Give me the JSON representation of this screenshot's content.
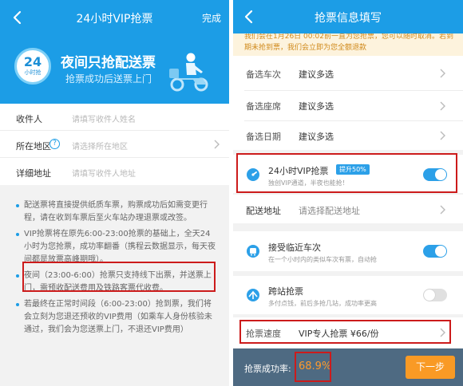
{
  "left": {
    "header": {
      "title": "24小时VIP抢票",
      "done_label": "完成"
    },
    "banner": {
      "badge_num": "24",
      "badge_sub": "小时抢",
      "title": "夜间只抢配送票",
      "subtitle": "抢票成功后送票上门"
    },
    "form": {
      "recipient": {
        "label": "收件人",
        "placeholder": "请填写收件人姓名"
      },
      "region": {
        "label": "所在地区",
        "placeholder": "请选择所在地区"
      },
      "address": {
        "label": "详细地址",
        "placeholder": "请填写收件人地址"
      }
    },
    "notes": [
      "配送票将直接提供纸质车票，购票成功后如需变更行程，请在收到车票后至火车站办理退票或改签。",
      "VIP抢票将在原先6:00-23:00抢票的基础上，全天24小时为您抢票，成功率翻番（携程云数据显示，每天夜间都是放票高峰期哦）。",
      "夜间（23:00-6:00）抢票只支持线下出票，并送票上门，需预收配送费用及铁路客票代收费。",
      "若最终在正常时间段（6:00-23:00）抢到票，我们将会立刻为您退还预收的VIP费用（如乘车人身份核验未通过，我们会为您送票上门，不退还VIP费用）"
    ]
  },
  "right": {
    "header": {
      "title": "抢票信息填写"
    },
    "notice": "我们会在1月26日 00:02前一直为您抢票，您可以随时取消。若到期未抢到票，我们会立即为您全额退款",
    "rows": {
      "train": {
        "label": "备选车次",
        "value": "建议多选"
      },
      "seat": {
        "label": "备选座席",
        "value": "建议多选"
      },
      "date": {
        "label": "备选日期",
        "value": "建议多选"
      }
    },
    "vip": {
      "title": "24小时VIP抢票",
      "badge": "提升50%",
      "subtitle": "独创VIP通道，半夜也能抢！",
      "enabled": true
    },
    "delivery": {
      "label": "配送地址",
      "placeholder": "请选择配送地址"
    },
    "nearby": {
      "title": "接受临近车次",
      "subtitle": "在一个小时内的类似车次有票，自动抢",
      "enabled": true
    },
    "transfer": {
      "title": "跨站抢票",
      "subtitle": "多付点钱，前后多抢几站，成功率更高",
      "enabled": false
    },
    "speed": {
      "label": "抢票速度",
      "value": "VIP专人抢票 ¥66/份"
    },
    "footer": {
      "rate_label": "抢票成功率:",
      "rate_value": "68.9%",
      "next_label": "下一步"
    },
    "colors": {
      "accent": "#1c9de6",
      "orange": "#f99a25",
      "highlight": "#cc1b1b",
      "footer": "#4e6a82"
    }
  }
}
